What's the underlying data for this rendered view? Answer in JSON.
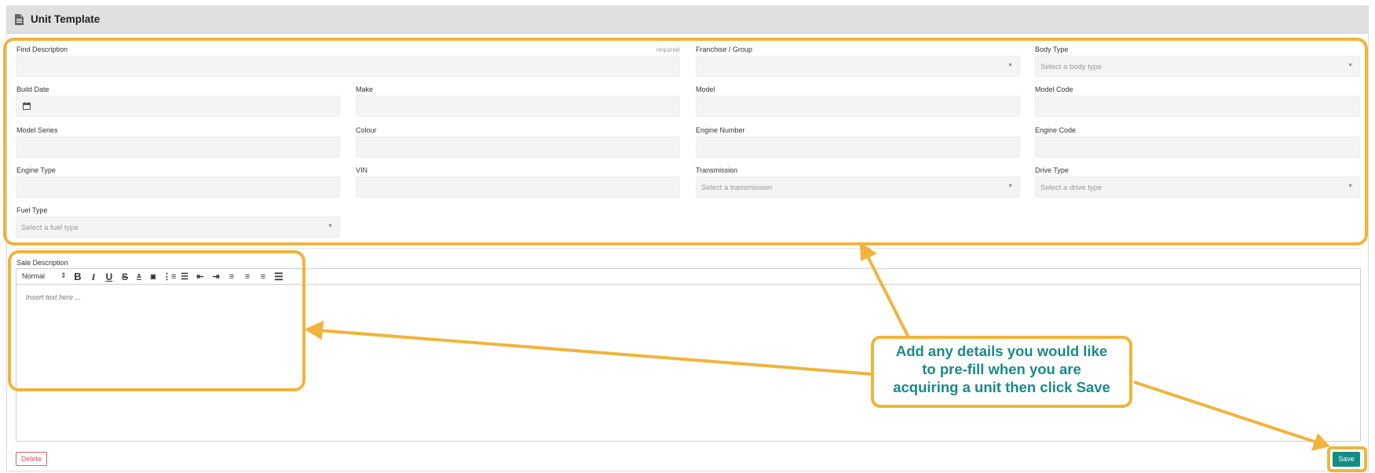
{
  "header": {
    "title": "Unit Template",
    "icon": "document-icon"
  },
  "fields": {
    "find_description": {
      "label": "Find Description",
      "required": "required",
      "value": ""
    },
    "franchise_group": {
      "label": "Franchise / Group",
      "value": ""
    },
    "body_type": {
      "label": "Body Type",
      "placeholder": "Select a body type"
    },
    "build_date": {
      "label": "Build Date",
      "value": ""
    },
    "make": {
      "label": "Make",
      "value": ""
    },
    "model": {
      "label": "Model",
      "value": ""
    },
    "model_code": {
      "label": "Model Code",
      "value": ""
    },
    "model_series": {
      "label": "Model Series",
      "value": ""
    },
    "colour": {
      "label": "Colour",
      "value": ""
    },
    "engine_number": {
      "label": "Engine Number",
      "value": ""
    },
    "engine_code": {
      "label": "Engine Code",
      "value": ""
    },
    "engine_type": {
      "label": "Engine Type",
      "value": ""
    },
    "vin": {
      "label": "VIN",
      "value": ""
    },
    "transmission": {
      "label": "Transmission",
      "placeholder": "Select a transmission"
    },
    "drive_type": {
      "label": "Drive Type",
      "placeholder": "Select a drive type"
    },
    "fuel_type": {
      "label": "Fuel Type",
      "placeholder": "Select a fuel type"
    },
    "sale_description": {
      "label": "Sale Description",
      "placeholder": "Insert text here ...",
      "format": "Normal"
    }
  },
  "actions": {
    "delete_label": "Delete",
    "save_label": "Save"
  },
  "annotation": {
    "text_line1": "Add any details you would like",
    "text_line2": "to pre-fill when you are",
    "text_line3": "acquiring a unit then click Save",
    "color": "#f0b43c",
    "text_color": "#1a8a87"
  },
  "colors": {
    "accent": "#138c85",
    "danger": "#d9534f",
    "header_bg": "#e0e0e0",
    "input_bg": "#f4f4f4"
  }
}
